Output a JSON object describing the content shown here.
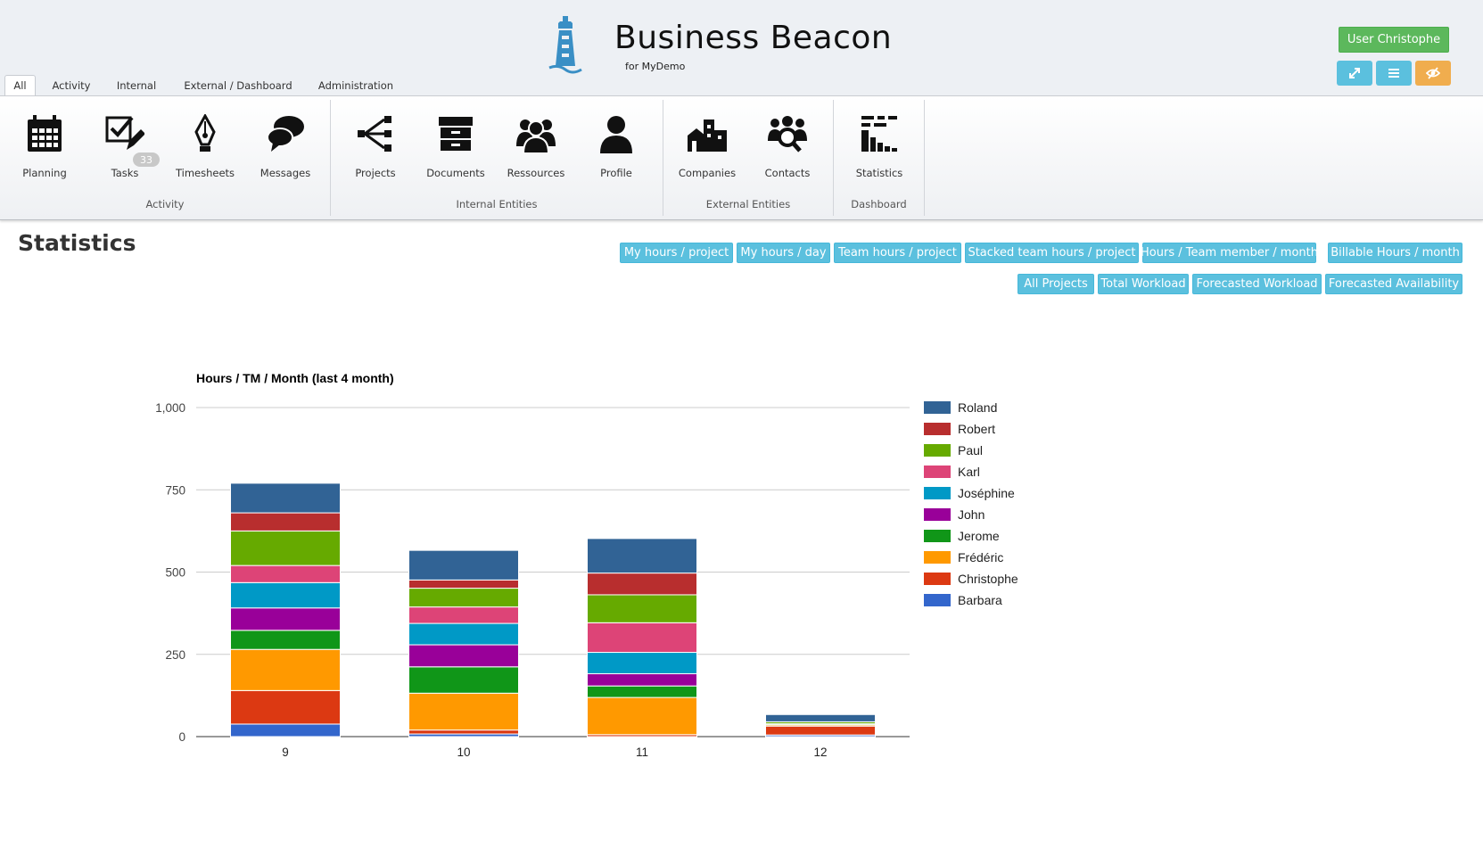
{
  "header": {
    "app_title": "Business Beacon",
    "app_subtitle": "for MyDemo",
    "user_button": "User Christophe",
    "icons": [
      "lighthouse-logo",
      "expand-icon",
      "menu-icon",
      "visibility-icon"
    ]
  },
  "tabs": [
    {
      "label": "All",
      "active": true
    },
    {
      "label": "Activity",
      "active": false
    },
    {
      "label": "Internal",
      "active": false
    },
    {
      "label": "External / Dashboard",
      "active": false
    },
    {
      "label": "Administration",
      "active": false
    }
  ],
  "ribbon": {
    "groups": [
      {
        "label": "Activity",
        "items": [
          {
            "label": "Planning",
            "icon": "calendar-icon"
          },
          {
            "label": "Tasks",
            "icon": "tasks-icon",
            "badge": "33"
          },
          {
            "label": "Timesheets",
            "icon": "pen-nib-icon"
          },
          {
            "label": "Messages",
            "icon": "chat-bubbles-icon"
          }
        ]
      },
      {
        "label": "Internal Entities",
        "items": [
          {
            "label": "Projects",
            "icon": "tree-icon"
          },
          {
            "label": "Documents",
            "icon": "archive-icon"
          },
          {
            "label": "Ressources",
            "icon": "group-icon"
          },
          {
            "label": "Profile",
            "icon": "person-icon"
          }
        ]
      },
      {
        "label": "External Entities",
        "items": [
          {
            "label": "Companies",
            "icon": "buildings-icon"
          },
          {
            "label": "Contacts",
            "icon": "contact-search-icon"
          }
        ]
      },
      {
        "label": "Dashboard",
        "items": [
          {
            "label": "Statistics",
            "icon": "statistics-icon"
          }
        ]
      }
    ]
  },
  "page": {
    "title": "Statistics",
    "buttons_row1": [
      "My hours / project",
      "My hours / day",
      "Team hours / project",
      "Stacked team hours / project",
      "Hours / Team member / month",
      "Billable Hours / month"
    ],
    "buttons_row2": [
      "All Projects",
      "Total Workload",
      "Forecasted Workload",
      "Forecasted Availability"
    ]
  },
  "colors": {
    "header_bg": "#edf0f4",
    "primary_button": "#5bc0de",
    "success_button": "#5cb85c",
    "warning_button": "#f0ad4e"
  },
  "chart_data": {
    "type": "bar",
    "stacked": true,
    "title": "Hours / TM / Month (last 4 month)",
    "categories": [
      "9",
      "10",
      "11",
      "12"
    ],
    "ylim": [
      0,
      1000
    ],
    "yticks": [
      "0",
      "250",
      "500",
      "750",
      "1,000"
    ],
    "ytick_values": [
      0,
      250,
      500,
      750,
      1000
    ],
    "grid": true,
    "legend_position": "right",
    "series": [
      {
        "name": "Barbara",
        "color": "#3366cc",
        "values": [
          38,
          8,
          0,
          5
        ]
      },
      {
        "name": "Christophe",
        "color": "#dc3912",
        "values": [
          102,
          12,
          6,
          27
        ]
      },
      {
        "name": "Frédéric",
        "color": "#ff9900",
        "values": [
          125,
          112,
          113,
          4
        ]
      },
      {
        "name": "Jerome",
        "color": "#109618",
        "values": [
          58,
          80,
          35,
          3
        ]
      },
      {
        "name": "John",
        "color": "#990099",
        "values": [
          68,
          67,
          37,
          0
        ]
      },
      {
        "name": "Joséphine",
        "color": "#0099c6",
        "values": [
          77,
          65,
          65,
          0
        ]
      },
      {
        "name": "Karl",
        "color": "#dd4477",
        "values": [
          52,
          50,
          90,
          0
        ]
      },
      {
        "name": "Paul",
        "color": "#66aa00",
        "values": [
          105,
          57,
          85,
          6
        ]
      },
      {
        "name": "Robert",
        "color": "#b82e2e",
        "values": [
          55,
          25,
          66,
          0
        ]
      },
      {
        "name": "Roland",
        "color": "#316395",
        "values": [
          90,
          90,
          105,
          22
        ]
      }
    ]
  }
}
